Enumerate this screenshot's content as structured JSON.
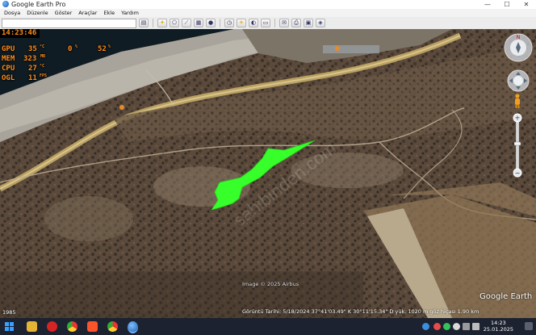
{
  "window": {
    "title": "Google Earth Pro",
    "minimize": "—",
    "maximize": "☐",
    "close": "✕"
  },
  "menu": [
    "Dosya",
    "Düzenle",
    "Göster",
    "Araçlar",
    "Ekle",
    "Yardım"
  ],
  "hud": {
    "time": "14:23:46",
    "gpu": {
      "label": "GPU",
      "value": "35",
      "unit": "°C",
      "load": "0",
      "load_unit": "%",
      "extra": "52",
      "extra_unit": "%"
    },
    "mem": {
      "label": "MEM",
      "value": "323",
      "unit": "MB"
    },
    "cpu": {
      "label": "CPU",
      "value": "27",
      "unit": "°C"
    },
    "ogl": {
      "label": "OGL",
      "value": "11",
      "unit": "FPS"
    }
  },
  "map": {
    "image_credit": "Image © 2025 Airbus",
    "logo": "Google Earth",
    "historical_year": "1985",
    "status": "Görüntü Tarihi: 5/18/2024     37°41'03.49\" K   30°11'15.34\" D   yük. 1020 m     göz hiçası   1.90 km",
    "parcel_color": "#36ff2a"
  },
  "taskbar": {
    "time": "14:23",
    "date": "25.01.2025"
  }
}
